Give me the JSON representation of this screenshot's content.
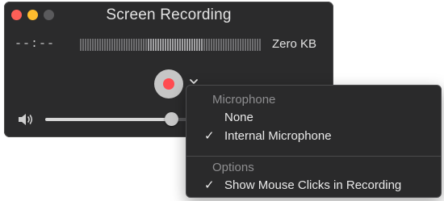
{
  "window": {
    "title": "Screen Recording",
    "elapsed_time": "--:--",
    "file_size": "Zero KB",
    "volume_level": 0.87
  },
  "options_menu": {
    "microphone_header": "Microphone",
    "microphone_items": [
      {
        "label": "None",
        "checked": false
      },
      {
        "label": "Internal Microphone",
        "checked": true
      }
    ],
    "options_header": "Options",
    "options_items": [
      {
        "label": "Show Mouse Clicks in Recording",
        "checked": true
      }
    ],
    "check_glyph": "✓"
  },
  "colors": {
    "window_bg": "#2b2b2c",
    "record_red": "#ff4b50",
    "close_red": "#fe5f57",
    "minimize_yellow": "#febc2e"
  },
  "icons": {
    "record": "record-icon",
    "chevron": "chevron-down-icon",
    "speaker": "speaker-icon"
  }
}
